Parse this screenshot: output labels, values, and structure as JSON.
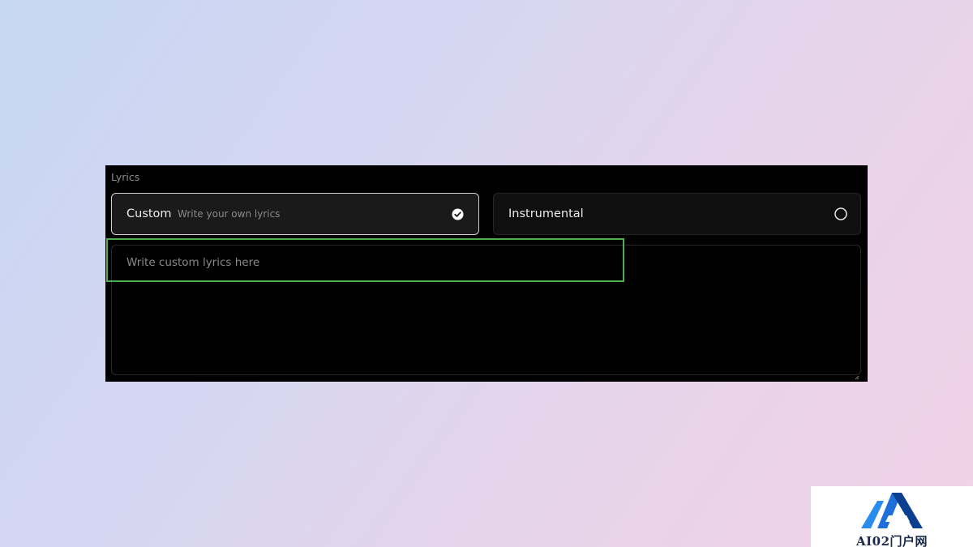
{
  "lyrics": {
    "section_label": "Lyrics",
    "options": [
      {
        "title": "Custom",
        "subtitle": "Write your own lyrics",
        "selected": true
      },
      {
        "title": "Instrumental",
        "subtitle": "",
        "selected": false
      }
    ],
    "textarea": {
      "placeholder": "Write custom lyrics here",
      "value": ""
    }
  },
  "watermark": {
    "text": "AI02门户网"
  },
  "colors": {
    "panel_bg": "#000000",
    "selected_border": "#cfcfcf",
    "highlight": "#4caf50",
    "logo_blue": "#1e6fd9"
  },
  "icons": {
    "selected_option": "check-circle-icon",
    "unselected_option": "radio-circle-icon",
    "textarea_corner": "resize-handle-icon"
  }
}
